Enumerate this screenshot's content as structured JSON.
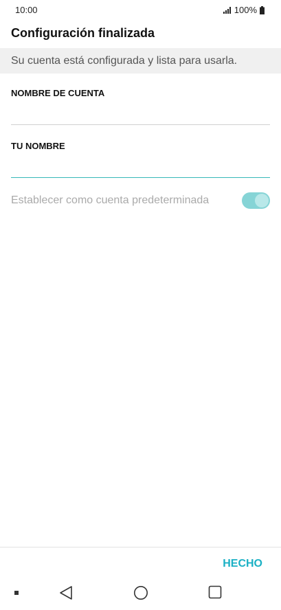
{
  "status_bar": {
    "time": "10:00",
    "battery": "100%",
    "icons": [
      "signal-icon",
      "battery-icon"
    ]
  },
  "header": {
    "title": "Configuración finalizada"
  },
  "banner": {
    "text": "Su cuenta está configurada y lista para usarla."
  },
  "form": {
    "account_name": {
      "label": "NOMBRE DE CUENTA",
      "value": ""
    },
    "your_name": {
      "label": "TU NOMBRE",
      "value": ""
    },
    "default_account": {
      "label": "Establecer como cuenta predeterminada",
      "enabled": true
    }
  },
  "footer": {
    "done_label": "HECHO"
  },
  "nav": {
    "icons": [
      "recent-dot-icon",
      "back-icon",
      "home-icon",
      "overview-icon"
    ]
  },
  "colors": {
    "accent": "#1ab0c4",
    "toggle_track": "#86d4d6",
    "banner_bg": "#f0f0f0"
  }
}
